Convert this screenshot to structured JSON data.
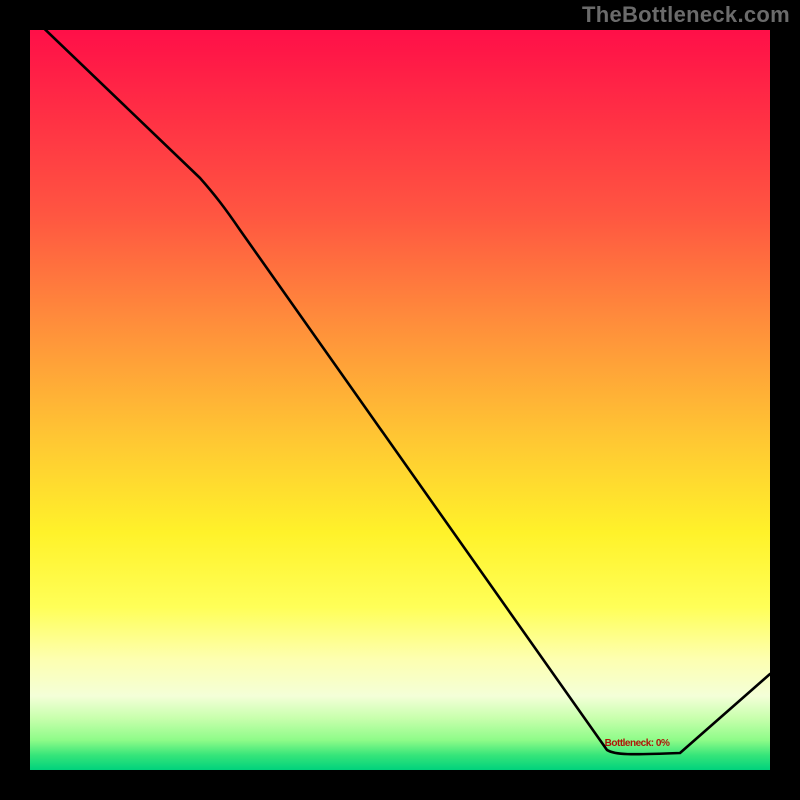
{
  "watermark": "TheBottleneck.com",
  "marker": {
    "label": "Bottleneck: 0%",
    "x_frac": 0.82,
    "y_frac": 0.955
  },
  "chart_data": {
    "type": "line",
    "title": "",
    "xlabel": "",
    "ylabel": "",
    "xlim": [
      0,
      1
    ],
    "ylim": [
      0,
      1
    ],
    "color_scale": "red (high bottleneck) → yellow → green (0% bottleneck)",
    "series": [
      {
        "name": "bottleneck-curve",
        "points": [
          {
            "x": 0.0,
            "y": 1.02
          },
          {
            "x": 0.23,
            "y": 0.8
          },
          {
            "x": 0.78,
            "y": 0.025
          },
          {
            "x": 0.88,
            "y": 0.025
          },
          {
            "x": 1.0,
            "y": 0.13
          }
        ]
      }
    ],
    "optimal_region_x": [
      0.78,
      0.88
    ],
    "notes": "Black curve over vertical heat gradient; minimum (green / 0% bottleneck) around x≈0.82; no axis ticks or numeric labels visible."
  }
}
